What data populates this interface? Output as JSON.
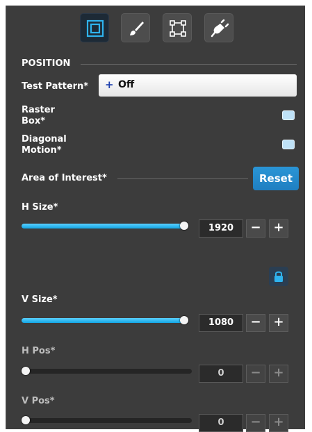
{
  "tabs": [
    {
      "name": "position-tab-icon",
      "active": true
    },
    {
      "name": "brush-icon",
      "active": false
    },
    {
      "name": "crop-frame-icon",
      "active": false
    },
    {
      "name": "plug-icon",
      "active": false
    }
  ],
  "section": {
    "title": "POSITION"
  },
  "test_pattern": {
    "label": "Test Pattern*",
    "plus": "+",
    "value": "Off"
  },
  "raster_box": {
    "label_line1": "Raster",
    "label_line2": "Box*"
  },
  "diagonal_motion": {
    "label_line1": "Diagonal",
    "label_line2": "Motion*"
  },
  "area_of_interest": {
    "label": "Area of Interest*",
    "reset_label": "Reset"
  },
  "h_size": {
    "label": "H Size*",
    "value": "1920",
    "level": 1.0
  },
  "v_size": {
    "label": "V Size*",
    "value": "1080",
    "level": 1.0
  },
  "h_pos": {
    "label": "H Pos*",
    "value": "0",
    "level": 0.0
  },
  "v_pos": {
    "label": "V Pos*",
    "value": "0",
    "level": 0.0
  },
  "stepper": {
    "minus": "−",
    "plus": "+"
  },
  "colors": {
    "accent": "#1f8fd3",
    "panel": "#3c3c3c",
    "slider_fill": "#13a5e3"
  }
}
